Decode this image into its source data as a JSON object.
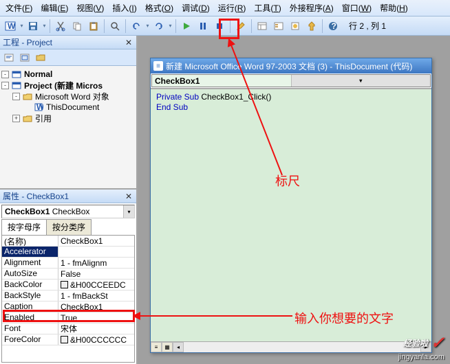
{
  "menubar": [
    {
      "label": "文件",
      "hotkey": "F"
    },
    {
      "label": "编辑",
      "hotkey": "E"
    },
    {
      "label": "视图",
      "hotkey": "V"
    },
    {
      "label": "插入",
      "hotkey": "I"
    },
    {
      "label": "格式",
      "hotkey": "O"
    },
    {
      "label": "调试",
      "hotkey": "D"
    },
    {
      "label": "运行",
      "hotkey": "R"
    },
    {
      "label": "工具",
      "hotkey": "T"
    },
    {
      "label": "外接程序",
      "hotkey": "A"
    },
    {
      "label": "窗口",
      "hotkey": "W"
    },
    {
      "label": "帮助",
      "hotkey": "H"
    }
  ],
  "status": "行 2 , 列 1",
  "project_panel": {
    "title": "工程 - Project",
    "tree": [
      {
        "indent": 0,
        "toggle": "-",
        "icon": "proj",
        "label": "Normal",
        "bold": true
      },
      {
        "indent": 0,
        "toggle": "-",
        "icon": "proj",
        "label": "Project (新建 Micros",
        "bold": true
      },
      {
        "indent": 1,
        "toggle": "-",
        "icon": "folder",
        "label": "Microsoft Word 对象",
        "bold": false
      },
      {
        "indent": 2,
        "toggle": "",
        "icon": "doc",
        "label": "ThisDocument",
        "bold": false
      },
      {
        "indent": 1,
        "toggle": "+",
        "icon": "folder",
        "label": "引用",
        "bold": false
      }
    ]
  },
  "props_panel": {
    "title": "属性 - CheckBox1",
    "combo_bold": "CheckBox1",
    "combo_rest": " CheckBox",
    "tabs": [
      "按字母序",
      "按分类序"
    ],
    "active_tab": 0,
    "rows": [
      {
        "name": "(名称)",
        "val": "CheckBox1",
        "sel": false
      },
      {
        "name": "Accelerator",
        "val": "",
        "sel": true
      },
      {
        "name": "Alignment",
        "val": "1 - fmAlignm",
        "sel": false
      },
      {
        "name": "AutoSize",
        "val": "False",
        "sel": false
      },
      {
        "name": "BackColor",
        "val": "&H00CCEEDC",
        "sel": false,
        "swatch": true
      },
      {
        "name": "BackStyle",
        "val": "1 - fmBackSt",
        "sel": false
      },
      {
        "name": "Caption",
        "val": "CheckBox1",
        "sel": false
      },
      {
        "name": "Enabled",
        "val": "True",
        "sel": false
      },
      {
        "name": "Font",
        "val": "宋体",
        "sel": false
      },
      {
        "name": "ForeColor",
        "val": "&H00CCCCCC",
        "sel": false,
        "swatch": true
      }
    ]
  },
  "code_window": {
    "title": "新建 Microsoft Office Word 97-2003 文档 (3) - ThisDocument (代码)",
    "drop_left": "CheckBox1",
    "lines": [
      {
        "parts": [
          {
            "t": "Private Sub",
            "cls": "kw"
          },
          {
            "t": " CheckBox1_Click()",
            "cls": ""
          }
        ]
      },
      {
        "parts": [
          {
            "t": "",
            "cls": ""
          }
        ]
      },
      {
        "parts": [
          {
            "t": "End Sub",
            "cls": "kw"
          }
        ]
      }
    ]
  },
  "annotations": {
    "ruler": "标尺",
    "input_text": "输入你想要的文字"
  },
  "watermark": {
    "title": "经验啦",
    "sub": "jingyanla.com"
  }
}
